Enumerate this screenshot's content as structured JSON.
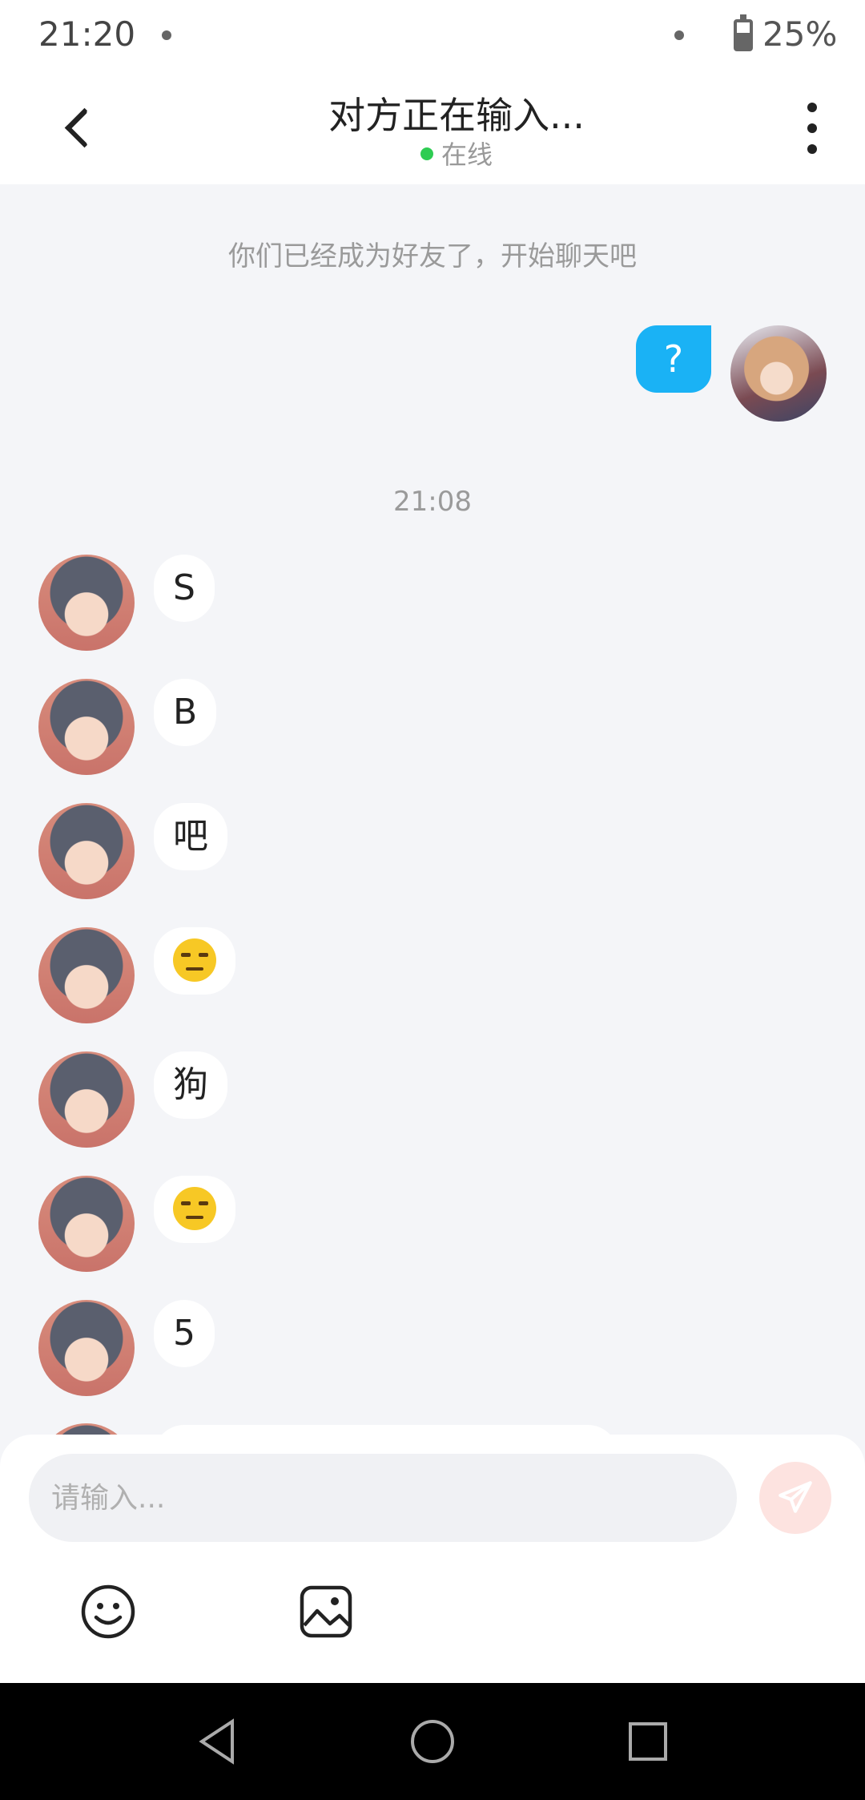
{
  "status_bar": {
    "time": "21:20",
    "battery": "25%"
  },
  "header": {
    "title": "对方正在输入...",
    "status": "在线"
  },
  "chat": {
    "system_note": "你们已经成为好友了，开始聊天吧",
    "outgoing": [
      {
        "text": "?"
      }
    ],
    "time_divider": "21:08",
    "incoming": [
      {
        "text": "S",
        "type": "text"
      },
      {
        "text": "B",
        "type": "text"
      },
      {
        "text": "吧",
        "type": "text"
      },
      {
        "text": "",
        "type": "emoji",
        "emoji": "unamused-face"
      },
      {
        "text": "狗",
        "type": "text"
      },
      {
        "text": "",
        "type": "emoji",
        "emoji": "unamused-face"
      },
      {
        "text": "5",
        "type": "text"
      }
    ]
  },
  "composer": {
    "placeholder": "请输入...",
    "send_icon": "send-icon",
    "tools": [
      "emoji-icon",
      "image-icon"
    ]
  },
  "nav": [
    "back-triangle-icon",
    "home-circle-icon",
    "recents-square-icon"
  ],
  "colors": {
    "outgoing_bubble": "#1ab2f5",
    "online": "#2ecc52",
    "send_disabled": "#fde3e0"
  }
}
